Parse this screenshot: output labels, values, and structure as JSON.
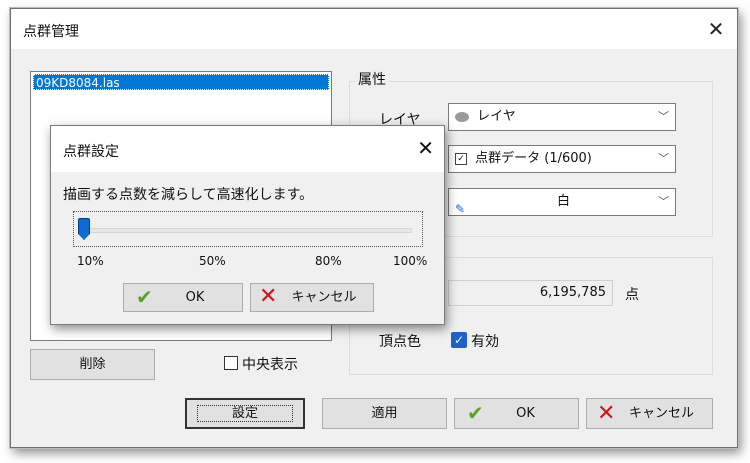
{
  "window": {
    "title": "点群管理",
    "close_glyph": "✕"
  },
  "pointcloud_list": {
    "items": [
      {
        "name": "09KD8084.las",
        "selected": true
      }
    ]
  },
  "left_buttons": {
    "delete_label": "削除",
    "center_display_label": "中央表示",
    "center_display_checked": false
  },
  "attributes": {
    "group_label": "属性",
    "layer_label": "レイヤ",
    "layer_value": "レイヤ",
    "data_value": "点群データ (1/600)",
    "color_value": "白"
  },
  "info": {
    "point_count": "6,195,785",
    "point_unit": "点",
    "vertex_color_label": "頂点色",
    "vertex_color_checkbox_label": "有効",
    "vertex_color_checked": true
  },
  "footer": {
    "settings_label": "設定",
    "apply_label": "適用",
    "ok_label": "OK",
    "cancel_label": "キャンセル"
  },
  "dialog": {
    "title": "点群設定",
    "close_glyph": "✕",
    "description": "描画する点数を減らして高速化します。",
    "slider_value_percent": 10,
    "slider_min_percent": 10,
    "slider_max_percent": 100,
    "ticks": [
      "10%",
      "50%",
      "80%",
      "100%"
    ],
    "ok_label": "OK",
    "cancel_label": "キャンセル"
  },
  "colors": {
    "accent": "#0078d7",
    "ok_green": "#58a61f",
    "cancel_red": "#d0141b"
  },
  "icons": {
    "layer": "layer-icon",
    "data": "checkbox-icon",
    "color": "paint-icon",
    "ok": "check-icon",
    "cancel": "x-icon"
  }
}
